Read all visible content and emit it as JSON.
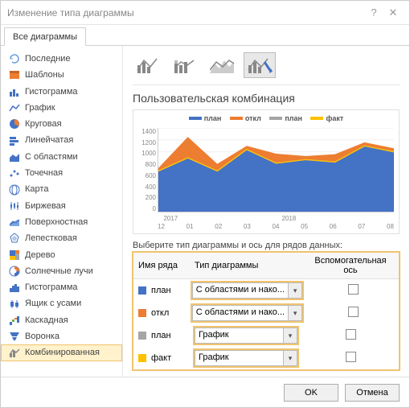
{
  "title": "Изменение типа диаграммы",
  "tab_all": "Все диаграммы",
  "sidebar": {
    "items": [
      {
        "label": "Последние"
      },
      {
        "label": "Шаблоны"
      },
      {
        "label": "Гистограмма"
      },
      {
        "label": "График"
      },
      {
        "label": "Круговая"
      },
      {
        "label": "Линейчатая"
      },
      {
        "label": "С областями"
      },
      {
        "label": "Точечная"
      },
      {
        "label": "Карта"
      },
      {
        "label": "Биржевая"
      },
      {
        "label": "Поверхностная"
      },
      {
        "label": "Лепестковая"
      },
      {
        "label": "Дерево"
      },
      {
        "label": "Солнечные лучи"
      },
      {
        "label": "Гистограмма"
      },
      {
        "label": "Ящик с усами"
      },
      {
        "label": "Каскадная"
      },
      {
        "label": "Воронка"
      },
      {
        "label": "Комбинированная"
      }
    ],
    "selected_index": 18
  },
  "section_title": "Пользовательская комбинация",
  "legend": {
    "plan": "план",
    "otkl": "откл",
    "plan2": "план",
    "fact": "факт"
  },
  "colors": {
    "plan": "#4472C4",
    "otkl": "#ED7D31",
    "plan2": "#A5A5A5",
    "fact": "#FFC000"
  },
  "grid_label": "Выберите тип диаграммы и ось для рядов данных:",
  "grid_headers": {
    "name": "Имя ряда",
    "type": "Тип диаграммы",
    "axis": "Вспомогательная ось"
  },
  "series": [
    {
      "name": "план",
      "color": "#4472C4",
      "chart_type": "С областями и нако...",
      "secondary": false
    },
    {
      "name": "откл",
      "color": "#ED7D31",
      "chart_type": "С областями и нако...",
      "secondary": false
    },
    {
      "name": "план",
      "color": "#A5A5A5",
      "chart_type": "График",
      "secondary": false
    },
    {
      "name": "факт",
      "color": "#FFC000",
      "chart_type": "График",
      "secondary": false
    }
  ],
  "buttons": {
    "ok": "OK",
    "cancel": "Отмена"
  },
  "chart_data": {
    "type": "area",
    "title": "",
    "ylim": [
      0,
      1400
    ],
    "yticks": [
      0,
      200,
      400,
      600,
      800,
      1000,
      1200,
      1400
    ],
    "x": [
      "12",
      "01",
      "02",
      "03",
      "04",
      "05",
      "06",
      "07",
      "08"
    ],
    "x_group": [
      "2017",
      "2018"
    ],
    "x_group_spans": [
      1,
      8
    ],
    "series": [
      {
        "name": "план",
        "type": "area-stacked",
        "color": "#4472C4",
        "values": [
          680,
          900,
          680,
          1040,
          810,
          870,
          830,
          1100,
          1000
        ]
      },
      {
        "name": "откл",
        "type": "area-stacked",
        "color": "#ED7D31",
        "values": [
          50,
          350,
          120,
          60,
          160,
          60,
          130,
          60,
          60
        ]
      },
      {
        "name": "план",
        "type": "line",
        "color": "#A5A5A5",
        "values": [
          680,
          900,
          680,
          1040,
          810,
          870,
          830,
          1100,
          1000
        ]
      },
      {
        "name": "факт",
        "type": "line",
        "color": "#FFC000",
        "values": [
          680,
          900,
          680,
          1040,
          810,
          870,
          830,
          1100,
          1000
        ]
      }
    ]
  }
}
